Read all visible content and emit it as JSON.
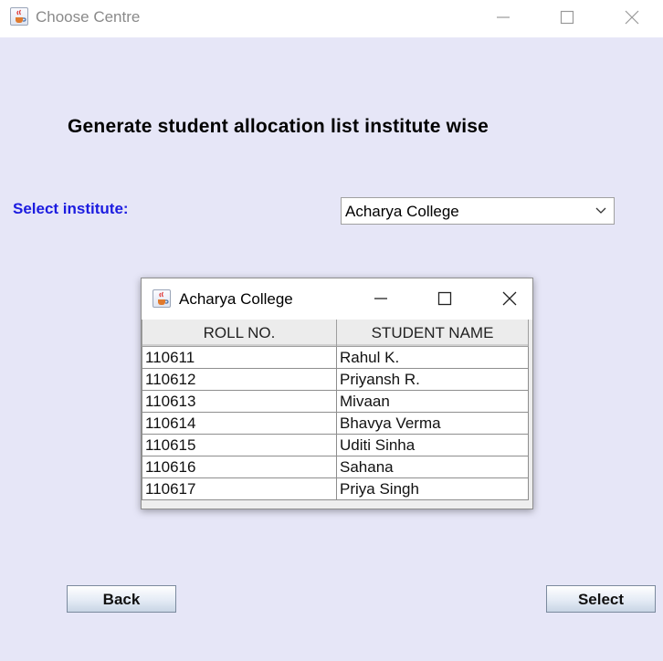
{
  "window": {
    "title": "Choose Centre"
  },
  "heading": "Generate student allocation list institute wise",
  "institute": {
    "label": "Select institute:",
    "selected": "Acharya College"
  },
  "dialog": {
    "title": "Acharya College",
    "columns": [
      "ROLL NO.",
      "STUDENT NAME"
    ],
    "rows": [
      [
        "110611",
        "Rahul K."
      ],
      [
        "110612",
        "Priyansh R."
      ],
      [
        "110613",
        "Mivaan"
      ],
      [
        "110614",
        "Bhavya Verma"
      ],
      [
        "110615",
        "Uditi Sinha"
      ],
      [
        "110616",
        "Sahana"
      ],
      [
        "110617",
        "Priya Singh"
      ]
    ]
  },
  "buttons": {
    "back": "Back",
    "select": "Select"
  },
  "colors": {
    "background": "#e6e6f7",
    "label_blue": "#1c1ce0"
  },
  "icons": [
    "java-app-icon",
    "minimize-icon",
    "maximize-icon",
    "close-icon",
    "chevron-down-icon"
  ]
}
